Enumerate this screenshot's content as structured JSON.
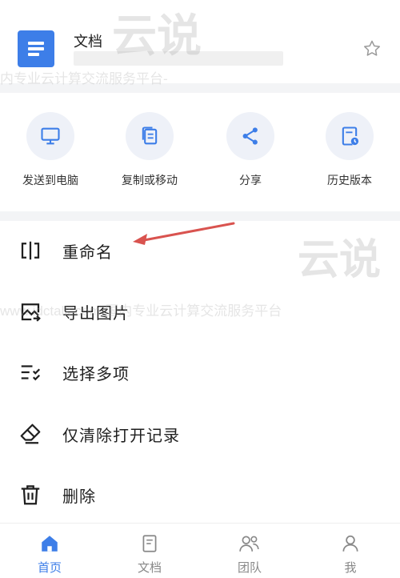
{
  "colors": {
    "accent": "#3d7ee8",
    "icon_bg": "#eef1f8",
    "arrow": "#d9534f"
  },
  "header": {
    "title": "文档",
    "star_icon": "star-outline-icon"
  },
  "watermark": {
    "brand": "云说",
    "line1": "内专业云计算交流服务平台-",
    "line2": "www.idctalk.com-国内专业云计算交流服务平台",
    "line3": "-www.idctalk.com-国内专"
  },
  "actions": [
    {
      "label": "发送到电脑",
      "icon": "computer-icon"
    },
    {
      "label": "复制或移动",
      "icon": "copy-icon"
    },
    {
      "label": "分享",
      "icon": "share-icon"
    },
    {
      "label": "历史版本",
      "icon": "history-icon"
    }
  ],
  "menu": [
    {
      "label": "重命名",
      "icon": "rename-icon"
    },
    {
      "label": "导出图片",
      "icon": "image-export-icon"
    },
    {
      "label": "选择多项",
      "icon": "multi-select-icon"
    },
    {
      "label": "仅清除打开记录",
      "icon": "eraser-icon"
    },
    {
      "label": "删除",
      "icon": "trash-icon"
    }
  ],
  "bottom_nav": [
    {
      "label": "首页",
      "icon": "home-icon",
      "active": true
    },
    {
      "label": "文档",
      "icon": "document-icon",
      "active": false
    },
    {
      "label": "团队",
      "icon": "team-icon",
      "active": false
    },
    {
      "label": "我",
      "icon": "person-icon",
      "active": false
    }
  ]
}
